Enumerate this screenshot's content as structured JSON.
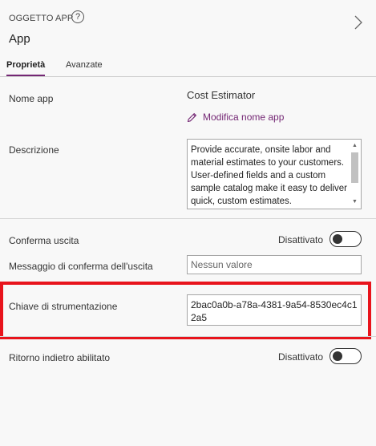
{
  "header": {
    "label": "OGGETTO APP",
    "help_glyph": "?",
    "title": "App",
    "help_icon": "question-circle-icon",
    "expand_icon": "chevron-right-icon"
  },
  "tabs": [
    {
      "label": "Proprietà",
      "active": true
    },
    {
      "label": "Avanzate",
      "active": false
    }
  ],
  "properties": {
    "name": {
      "label": "Nome app",
      "value": "Cost Estimator",
      "edit_link": "Modifica nome app",
      "edit_icon": "pencil-icon"
    },
    "description": {
      "label": "Descrizione",
      "value": "Provide accurate, onsite labor and material estimates to your customers. User-defined fields and a custom sample catalog make it easy to deliver quick, custom estimates."
    },
    "confirm_exit": {
      "label": "Conferma uscita",
      "state_label": "Disattivato",
      "enabled": false
    },
    "exit_message": {
      "label": "Messaggio di conferma dell'uscita",
      "placeholder": "Nessun valore"
    },
    "instrumentation_key": {
      "label": "Chiave di strumentazione",
      "value": "2bac0a0b-a78a-4381-9a54-8530ec4c12a5"
    },
    "back_enabled": {
      "label": "Ritorno indietro abilitato",
      "state_label": "Disattivato",
      "enabled": false
    }
  },
  "colors": {
    "accent": "#742774",
    "highlight": "#e8141c",
    "background": "#f8f8f8"
  }
}
